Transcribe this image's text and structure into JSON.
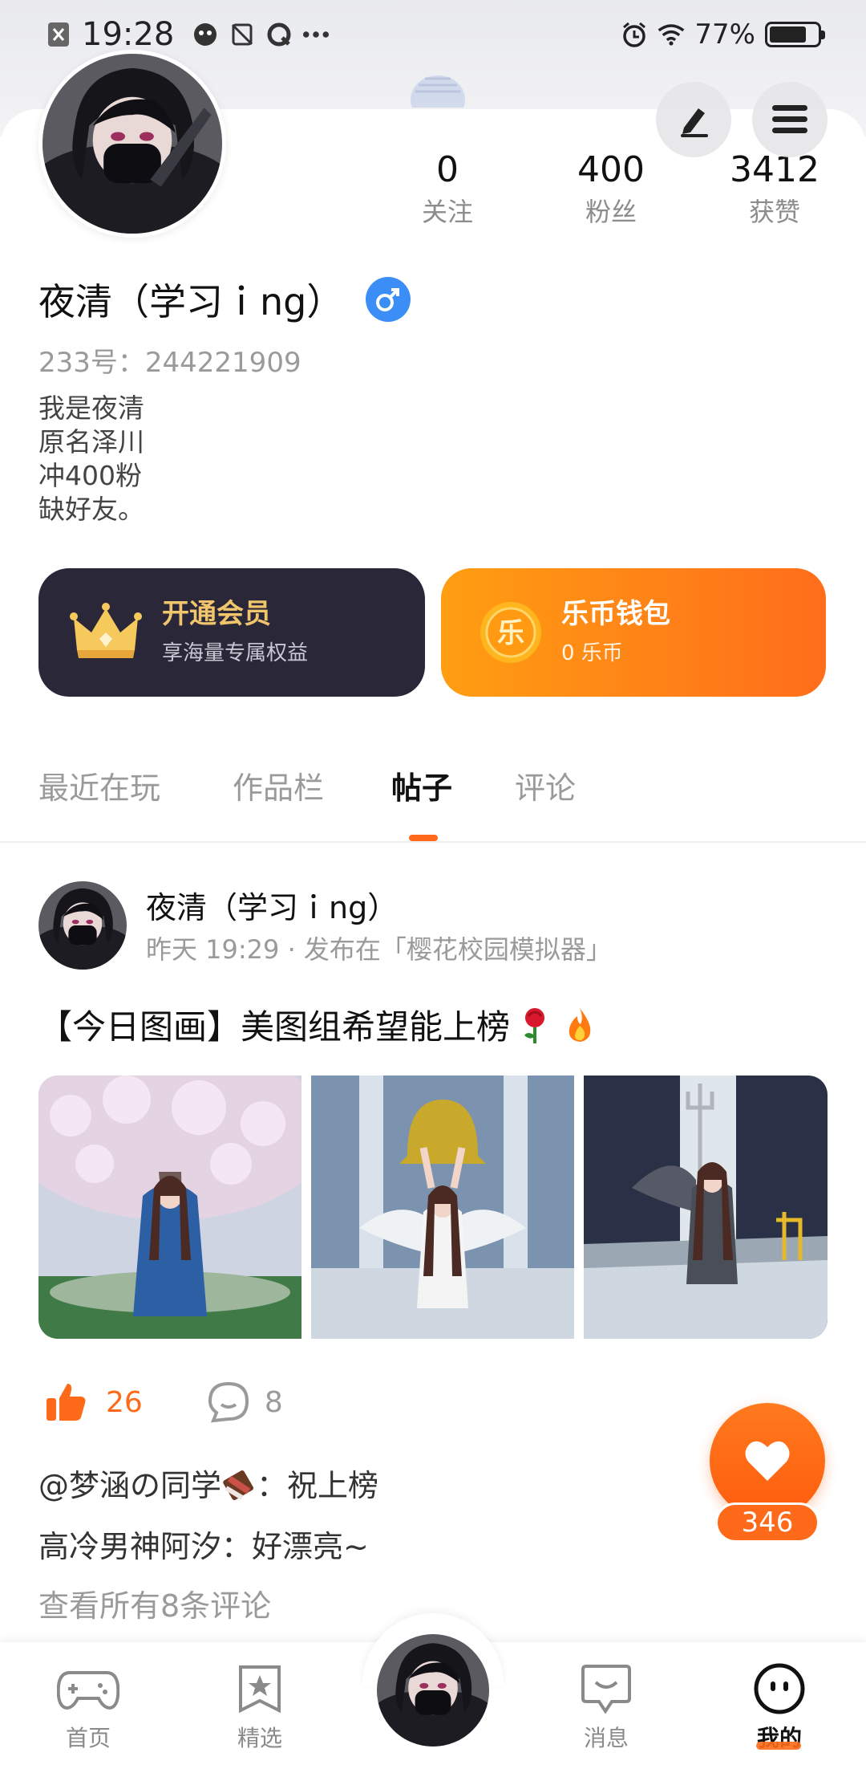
{
  "status_bar": {
    "time": "19:28",
    "battery": "77%",
    "battery_level": 0.77
  },
  "profile": {
    "stats": [
      {
        "num": "0",
        "label": "关注"
      },
      {
        "num": "400",
        "label": "粉丝"
      },
      {
        "num": "3412",
        "label": "获赞"
      }
    ],
    "nickname": "夜清（学习ｉng）",
    "uid": "233号：244221909",
    "bio": [
      "我是夜清",
      "原名泽川",
      "冲400粉",
      "缺好友。"
    ]
  },
  "cards": {
    "vip": {
      "title": "开通会员",
      "subtitle": "享海量专属权益"
    },
    "wallet": {
      "title": "乐币钱包",
      "subtitle": "0 乐币",
      "coin_glyph": "乐"
    }
  },
  "tabs": [
    {
      "label": "最近在玩",
      "active": false
    },
    {
      "label": "作品栏",
      "active": false
    },
    {
      "label": "帖子",
      "active": true
    },
    {
      "label": "评论",
      "active": false
    }
  ],
  "post": {
    "author": "夜清（学习ｉng）",
    "meta": "昨天 19:29 · 发布在「樱花校园模拟器」",
    "title": "【今日图画】美图组希望能上榜",
    "likes": "26",
    "comments": "8",
    "comment_list": [
      {
        "user": "@梦涵の同学",
        "text": "：祝上榜"
      },
      {
        "user": "高冷男神阿汐",
        "text": "：好漂亮~"
      }
    ],
    "see_all": "查看所有8条评论"
  },
  "favorite": {
    "count": "346"
  },
  "bottom_nav": [
    {
      "label": "首页",
      "icon": "gamepad-icon"
    },
    {
      "label": "精选",
      "icon": "star-badge-icon"
    },
    {
      "label": "",
      "icon": "avatar-center"
    },
    {
      "label": "消息",
      "icon": "chat-smile-icon"
    },
    {
      "label": "我的",
      "icon": "face-icon",
      "active": true
    }
  ],
  "colors": {
    "accent": "#ff6a1a",
    "vip_bg": "#2a2739",
    "vip_gold": "#f1c56b",
    "gender_blue": "#3a8ef6"
  }
}
